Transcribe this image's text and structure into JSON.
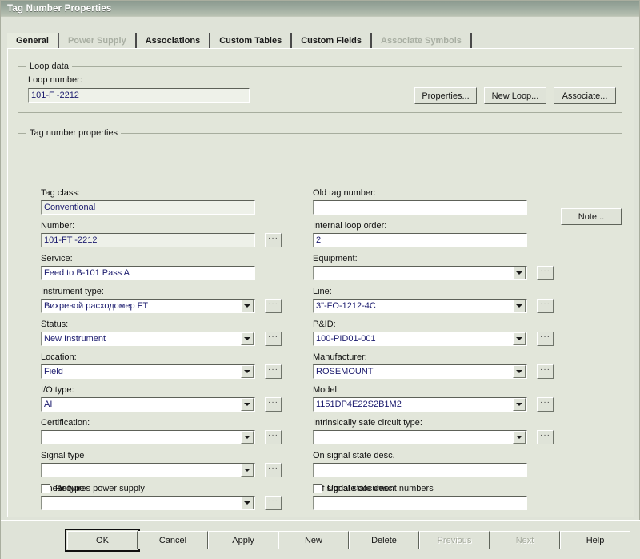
{
  "window": {
    "title": "Tag Number Properties"
  },
  "tabs": [
    {
      "label": "General",
      "state": "active"
    },
    {
      "label": "Power Supply",
      "state": "disabled"
    },
    {
      "label": "Associations",
      "state": "normal"
    },
    {
      "label": "Custom Tables",
      "state": "normal"
    },
    {
      "label": "Custom Fields",
      "state": "normal"
    },
    {
      "label": "Associate Symbols",
      "state": "disabled"
    }
  ],
  "loop_data": {
    "group_title": "Loop data",
    "loop_number_label": "Loop number:",
    "loop_number_value": "101-F -2212",
    "buttons": {
      "properties": "Properties...",
      "new_loop": "New Loop...",
      "associate": "Associate..."
    }
  },
  "tag_properties": {
    "group_title": "Tag number properties",
    "note_button": "Note...",
    "left": [
      {
        "label": "Tag class:",
        "value": "Conventional",
        "control": "text",
        "readonly": true,
        "browse": false
      },
      {
        "label": "Number:",
        "value": "101-FT  -2212",
        "control": "text",
        "readonly": true,
        "browse": true
      },
      {
        "label": "Service:",
        "value": "Feed to B-101 Pass A",
        "control": "text",
        "readonly": false,
        "browse": false
      },
      {
        "label": "Instrument type:",
        "value": "Вихревой расходомер      FT",
        "control": "combo",
        "readonly": false,
        "browse": true
      },
      {
        "label": "Status:",
        "value": "New Instrument",
        "control": "combo",
        "readonly": false,
        "browse": true
      },
      {
        "label": "Location:",
        "value": "Field",
        "control": "combo",
        "readonly": false,
        "browse": true
      },
      {
        "label": "I/O type:",
        "value": "AI",
        "control": "combo",
        "readonly": false,
        "browse": true
      },
      {
        "label": "Certification:",
        "value": "",
        "control": "combo",
        "readonly": false,
        "browse": true
      },
      {
        "label": "Signal type",
        "value": "",
        "control": "combo",
        "readonly": false,
        "browse": true
      },
      {
        "label": "Linear type",
        "value": "",
        "control": "combo",
        "readonly": false,
        "browse": true,
        "browse_disabled": true
      }
    ],
    "right": [
      {
        "label": "Old tag number:",
        "value": "",
        "control": "text",
        "browse": false
      },
      {
        "label": "Internal loop order:",
        "value": "2",
        "control": "text",
        "browse": false
      },
      {
        "label": "Equipment:",
        "value": "",
        "control": "combo",
        "browse": true
      },
      {
        "label": "Line:",
        "value": "3\"-FO-1212-4C",
        "control": "combo",
        "browse": true
      },
      {
        "label": "P&ID:",
        "value": "100-PID01-001",
        "control": "combo",
        "browse": true
      },
      {
        "label": "Manufacturer:",
        "value": "ROSEMOUNT",
        "control": "combo",
        "browse": true
      },
      {
        "label": "Model:",
        "value": "1151DP4E22S2B1M2",
        "control": "combo",
        "browse": true
      },
      {
        "label": "Intrinsically safe circuit type:",
        "value": "",
        "control": "combo",
        "browse": true
      },
      {
        "label": "On signal state desc.",
        "value": "",
        "control": "text",
        "browse": false
      },
      {
        "label": "Off signal state desc.",
        "value": "",
        "control": "text",
        "browse": false
      }
    ],
    "checkboxes": {
      "requires_power_supply": {
        "label": "Requires power supply",
        "checked": false
      },
      "update_document_numbers": {
        "label": "Update document numbers",
        "checked": false
      }
    }
  },
  "footer_buttons": [
    {
      "label": "OK",
      "state": "default"
    },
    {
      "label": "Cancel",
      "state": "normal"
    },
    {
      "label": "Apply",
      "state": "normal"
    },
    {
      "label": "New",
      "state": "normal"
    },
    {
      "label": "Delete",
      "state": "normal"
    },
    {
      "label": "Previous",
      "state": "disabled"
    },
    {
      "label": "Next",
      "state": "disabled"
    },
    {
      "label": "Help",
      "state": "normal"
    }
  ],
  "colors": {
    "dialog_face": "#dfe3d8",
    "tabpage_face": "#e2e6da",
    "field_text": "#1b1b6e",
    "titlebar_start": "#8b9a8f",
    "titlebar_end": "#b9c2b3"
  }
}
